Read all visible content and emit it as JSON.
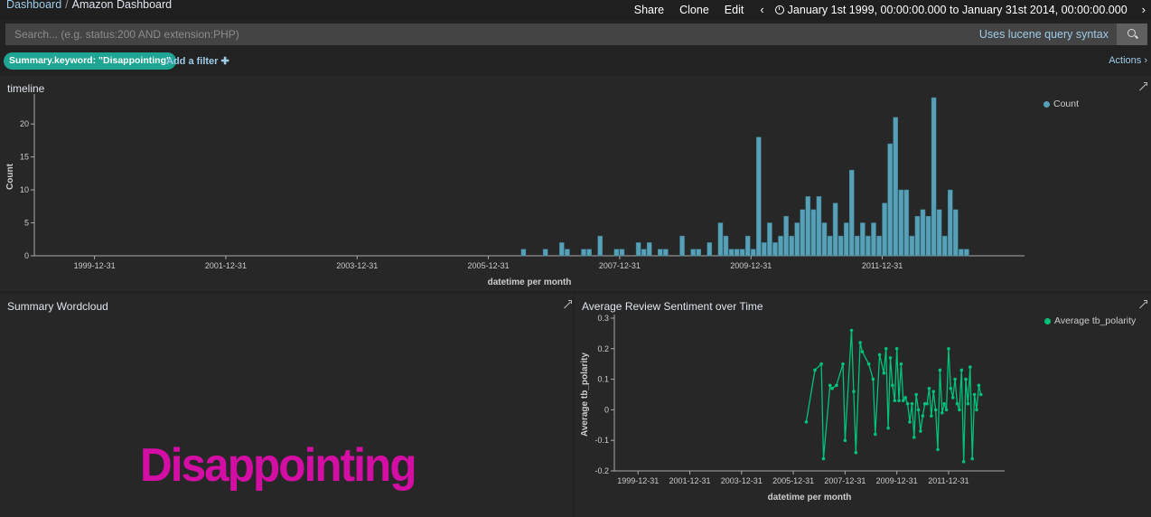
{
  "breadcrumb": {
    "root": "Dashboard",
    "separator": "/",
    "current": "Amazon Dashboard"
  },
  "topnav": {
    "share": "Share",
    "clone": "Clone",
    "edit": "Edit",
    "prev": "‹",
    "next": "›",
    "time_range": "January 1st 1999, 00:00:00.000 to January 31st 2014, 00:00:00.000"
  },
  "search": {
    "placeholder": "Search... (e.g. status:200 AND extension:PHP)",
    "value": "",
    "lucene_label": "Uses lucene query syntax"
  },
  "filters": {
    "active": "Summary.keyword: \"Disappointing\"",
    "add_label": "Add a filter ✚",
    "actions_label": "Actions ›"
  },
  "colors": {
    "bar": "#57a1b8",
    "line": "#00c27a",
    "wordcloud": "#d40ea5",
    "pill": "#1ea593",
    "link": "#9ecbe8"
  },
  "timeline": {
    "title": "timeline",
    "legend": "Count",
    "chart_data": {
      "type": "bar",
      "title": "timeline",
      "xlabel": "datetime per month",
      "ylabel": "Count",
      "ylim": [
        0,
        24
      ],
      "yticks": [
        0,
        5,
        10,
        15,
        20
      ],
      "xticks": [
        "1999-12-31",
        "2001-12-31",
        "2003-12-31",
        "2005-12-31",
        "2007-12-31",
        "2009-12-31",
        "2011-12-31"
      ],
      "series": [
        {
          "name": "Count",
          "x": [
            "2006-06",
            "2006-10",
            "2007-01",
            "2007-02",
            "2007-05",
            "2007-06",
            "2007-08",
            "2007-11",
            "2007-12",
            "2008-03",
            "2008-04",
            "2008-05",
            "2008-07",
            "2008-08",
            "2008-11",
            "2009-01",
            "2009-02",
            "2009-04",
            "2009-06",
            "2009-07",
            "2009-08",
            "2009-09",
            "2009-10",
            "2009-11",
            "2009-12",
            "2010-01",
            "2010-02",
            "2010-03",
            "2010-04",
            "2010-05",
            "2010-06",
            "2010-07",
            "2010-08",
            "2010-09",
            "2010-10",
            "2010-11",
            "2010-12",
            "2011-01",
            "2011-02",
            "2011-03",
            "2011-04",
            "2011-05",
            "2011-06",
            "2011-07",
            "2011-08",
            "2011-09",
            "2011-10",
            "2011-11",
            "2011-12",
            "2012-01",
            "2012-02",
            "2012-03",
            "2012-04",
            "2012-05",
            "2012-06",
            "2012-07",
            "2012-08",
            "2012-09",
            "2012-10",
            "2012-11",
            "2012-12",
            "2013-01",
            "2013-02",
            "2013-03"
          ],
          "values": [
            1,
            1,
            2,
            1,
            1,
            1,
            3,
            1,
            1,
            2,
            1,
            2,
            1,
            1,
            3,
            1,
            1,
            2,
            5,
            3,
            1,
            1,
            1,
            3,
            1,
            18,
            2,
            5,
            2,
            3,
            6,
            3,
            5,
            7,
            9,
            7,
            9,
            5,
            3,
            8,
            3,
            5,
            13,
            3,
            5,
            3,
            5,
            3,
            8,
            17,
            21,
            10,
            10,
            3,
            6,
            7,
            6,
            24,
            7,
            3,
            10,
            7,
            1,
            1
          ]
        }
      ]
    }
  },
  "wordcloud": {
    "title": "Summary Wordcloud",
    "word": "Disappointing"
  },
  "sentiment": {
    "title": "Average Review Sentiment over Time",
    "legend": "Average tb_polarity",
    "chart_data": {
      "type": "line",
      "title": "Average Review Sentiment over Time",
      "xlabel": "datetime per month",
      "ylabel": "Average tb_polarity",
      "ylim": [
        -0.2,
        0.3
      ],
      "yticks": [
        -0.2,
        -0.1,
        0,
        0.1,
        0.2,
        0.3
      ],
      "xticks": [
        "1999-12-31",
        "2001-12-31",
        "2003-12-31",
        "2005-12-31",
        "2007-12-31",
        "2009-12-31",
        "2011-12-31"
      ],
      "series": [
        {
          "name": "Average tb_polarity",
          "x": [
            "2006-06",
            "2006-10",
            "2007-01",
            "2007-02",
            "2007-05",
            "2007-06",
            "2007-08",
            "2007-11",
            "2007-12",
            "2008-03",
            "2008-04",
            "2008-05",
            "2008-07",
            "2008-08",
            "2008-11",
            "2009-01",
            "2009-02",
            "2009-04",
            "2009-06",
            "2009-07",
            "2009-08",
            "2009-09",
            "2009-10",
            "2009-11",
            "2009-12",
            "2010-01",
            "2010-02",
            "2010-03",
            "2010-04",
            "2010-05",
            "2010-06",
            "2010-07",
            "2010-08",
            "2010-09",
            "2010-10",
            "2010-11",
            "2010-12",
            "2011-01",
            "2011-02",
            "2011-03",
            "2011-04",
            "2011-05",
            "2011-06",
            "2011-07",
            "2011-08",
            "2011-09",
            "2011-10",
            "2011-11",
            "2011-12",
            "2012-01",
            "2012-02",
            "2012-03",
            "2012-04",
            "2012-05",
            "2012-06",
            "2012-07",
            "2012-08",
            "2012-09",
            "2012-10",
            "2012-11",
            "2012-12",
            "2013-01",
            "2013-02",
            "2013-03"
          ],
          "values": [
            -0.04,
            0.13,
            0.15,
            -0.16,
            0.08,
            0.07,
            0.08,
            0.15,
            -0.1,
            0.26,
            0.06,
            -0.14,
            0.22,
            0.19,
            0.15,
            0.1,
            -0.08,
            0.18,
            0.12,
            0.2,
            -0.06,
            0.17,
            0.08,
            0.03,
            0.2,
            0.03,
            0.15,
            0.03,
            0.04,
            0.02,
            -0.04,
            0.02,
            -0.09,
            0.05,
            0.0,
            -0.07,
            -0.02,
            0.02,
            0.02,
            0.07,
            -0.02,
            0.06,
            0.0,
            -0.13,
            0.13,
            -0.01,
            0.02,
            0.0,
            0.2,
            0.07,
            0.04,
            0.1,
            0.02,
            0.0,
            0.13,
            -0.17,
            0.1,
            0.02,
            0.14,
            -0.16,
            0.05,
            0.0,
            0.08,
            0.05,
            0.12,
            0.0,
            0.06,
            0.04
          ]
        }
      ]
    }
  }
}
